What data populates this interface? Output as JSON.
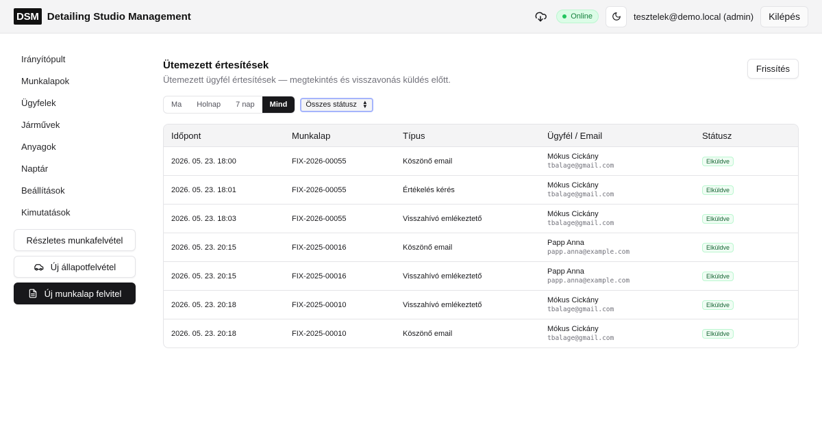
{
  "header": {
    "logo": "DSM",
    "title": "Detailing Studio Management",
    "status": "Online",
    "user": "tesztelek@demo.local (admin)",
    "logout_label": "Kilépés"
  },
  "sidebar": {
    "items": [
      {
        "label": "Irányítópult"
      },
      {
        "label": "Munkalapok"
      },
      {
        "label": "Ügyfelek"
      },
      {
        "label": "Járművek"
      },
      {
        "label": "Anyagok"
      },
      {
        "label": "Naptár"
      },
      {
        "label": "Beállítások"
      },
      {
        "label": "Kimutatások"
      }
    ],
    "detailed_btn": "Részletes munkafelvétel",
    "condition_btn": "Új állapotfelvétel",
    "new_sheet_btn": "Új munkalap felvitel"
  },
  "main": {
    "title": "Ütemezett értesítések",
    "subtitle": "Ütemezett ügyfél értesítések — megtekintés és visszavonás küldés előtt.",
    "refresh_label": "Frissítés",
    "filters": [
      {
        "label": "Ma",
        "active": false
      },
      {
        "label": "Holnap",
        "active": false
      },
      {
        "label": "7 nap",
        "active": false
      },
      {
        "label": "Mind",
        "active": true
      }
    ],
    "status_select": "Összes státusz",
    "columns": [
      "Időpont",
      "Munkalap",
      "Típus",
      "Ügyfél / Email",
      "Státusz"
    ],
    "rows": [
      {
        "time": "2026. 05. 23. 18:00",
        "sheet": "FIX-2026-00055",
        "type": "Köszönő email",
        "name": "Mókus Cickány",
        "email": "tbalage@gmail.com",
        "status": "Elküldve"
      },
      {
        "time": "2026. 05. 23. 18:01",
        "sheet": "FIX-2026-00055",
        "type": "Értékelés kérés",
        "name": "Mókus Cickány",
        "email": "tbalage@gmail.com",
        "status": "Elküldve"
      },
      {
        "time": "2026. 05. 23. 18:03",
        "sheet": "FIX-2026-00055",
        "type": "Visszahívó emlékeztető",
        "name": "Mókus Cickány",
        "email": "tbalage@gmail.com",
        "status": "Elküldve"
      },
      {
        "time": "2026. 05. 23. 20:15",
        "sheet": "FIX-2025-00016",
        "type": "Köszönő email",
        "name": "Papp Anna",
        "email": "papp.anna@example.com",
        "status": "Elküldve"
      },
      {
        "time": "2026. 05. 23. 20:15",
        "sheet": "FIX-2025-00016",
        "type": "Visszahívó emlékeztető",
        "name": "Papp Anna",
        "email": "papp.anna@example.com",
        "status": "Elküldve"
      },
      {
        "time": "2026. 05. 23. 20:18",
        "sheet": "FIX-2025-00010",
        "type": "Visszahívó emlékeztető",
        "name": "Mókus Cickány",
        "email": "tbalage@gmail.com",
        "status": "Elküldve"
      },
      {
        "time": "2026. 05. 23. 20:18",
        "sheet": "FIX-2025-00010",
        "type": "Köszönő email",
        "name": "Mókus Cickány",
        "email": "tbalage@gmail.com",
        "status": "Elküldve"
      }
    ]
  }
}
